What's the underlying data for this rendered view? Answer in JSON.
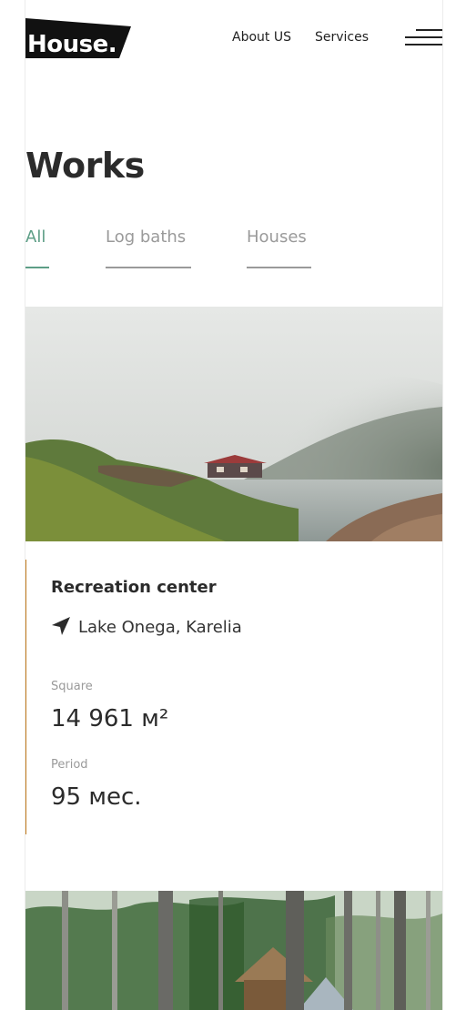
{
  "header": {
    "logo_text": "House.",
    "nav": {
      "about": "About US",
      "services": "Services"
    }
  },
  "page": {
    "title": "Works"
  },
  "tabs": [
    {
      "label": "All",
      "active": true
    },
    {
      "label": "Log baths",
      "active": false
    },
    {
      "label": "Houses",
      "active": false
    }
  ],
  "project": {
    "title": "Recreation center",
    "location": "Lake Onega, Karelia",
    "square_label": "Square",
    "square_value": "14 961 м²",
    "period_label": "Period",
    "period_value": "95 мес."
  },
  "colors": {
    "accent_green": "#5d9e86",
    "accent_orange": "#c27a1a",
    "text_dark": "#2b2b2b",
    "muted": "#9a9a9a"
  },
  "icons": {
    "menu": "hamburger-icon",
    "location": "location-arrow-icon"
  }
}
